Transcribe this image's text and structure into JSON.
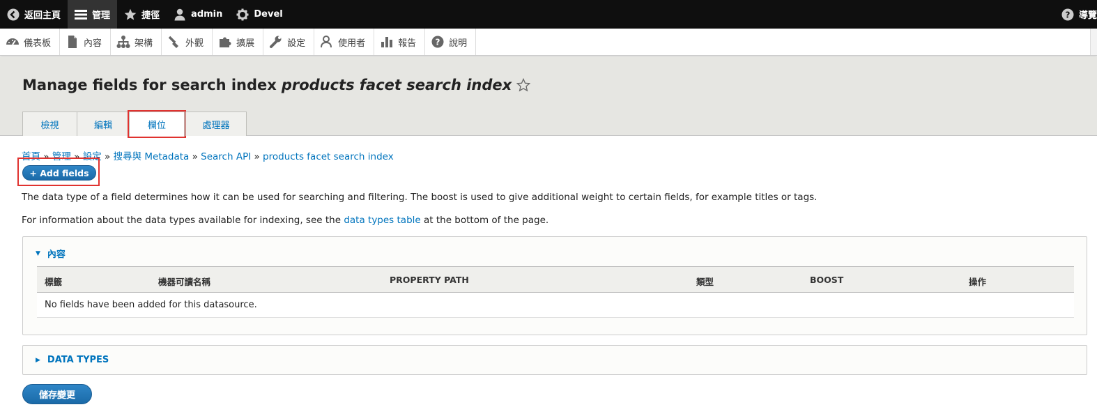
{
  "toolbar": {
    "back_label": "返回主頁",
    "manage_label": "管理",
    "shortcuts_label": "捷徑",
    "user_label": "admin",
    "devel_label": "Devel",
    "help_label": "導覽"
  },
  "tray": {
    "items": [
      {
        "label": "儀表板",
        "icon": "dashboard-icon"
      },
      {
        "label": "內容",
        "icon": "document-icon"
      },
      {
        "label": "架構",
        "icon": "structure-icon"
      },
      {
        "label": "外觀",
        "icon": "paintbrush-icon"
      },
      {
        "label": "擴展",
        "icon": "puzzle-icon"
      },
      {
        "label": "設定",
        "icon": "wrench-icon"
      },
      {
        "label": "使用者",
        "icon": "people-icon"
      },
      {
        "label": "報告",
        "icon": "bar-chart-icon"
      },
      {
        "label": "說明",
        "icon": "help-icon"
      }
    ]
  },
  "header": {
    "title_prefix": "Manage fields for search index",
    "title_em": "products facet search index",
    "tabs": [
      {
        "label": "檢視"
      },
      {
        "label": "編輯"
      },
      {
        "label": "欄位"
      },
      {
        "label": "處理器"
      }
    ]
  },
  "breadcrumb": {
    "items": [
      "首頁",
      "管理",
      "設定",
      "搜尋與 Metadata",
      "Search API",
      "products facet search index"
    ],
    "separator": "»"
  },
  "main": {
    "add_fields_label": "+ Add fields",
    "description": "The data type of a field determines how it can be used for searching and filtering. The boost is used to give additional weight to certain fields, for example titles or tags.",
    "info_prefix": "For information about the data types available for indexing, see the",
    "info_link": "data types table",
    "info_suffix": "at the bottom of the page.",
    "content_panel": {
      "summary": "內容",
      "columns": [
        "標籤",
        "機器可讀名稱",
        "PROPERTY PATH",
        "類型",
        "BOOST",
        "操作"
      ],
      "empty_text": "No fields have been added for this datasource."
    },
    "data_types_panel": {
      "summary": "DATA TYPES"
    },
    "save_label": "儲存變更"
  },
  "colors": {
    "link": "#0074bd",
    "toolbar_bg": "#0f0f0f",
    "button_bg": "#2477b9",
    "highlight": "#e0322f"
  }
}
